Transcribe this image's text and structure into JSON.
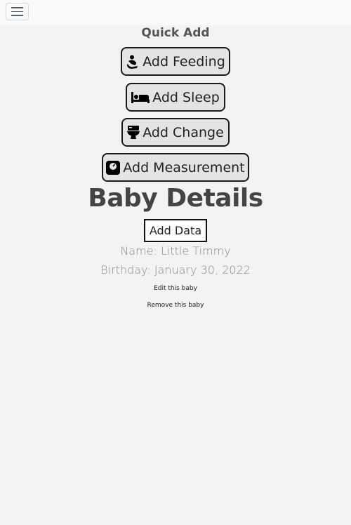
{
  "nav": {
    "menu_icon": "hamburger-menu-icon"
  },
  "quick_add": {
    "title": "Quick Add",
    "buttons": [
      {
        "label": "Add Feeding",
        "icon": "breastfeeding-icon"
      },
      {
        "label": "Add Sleep",
        "icon": "bed-icon"
      },
      {
        "label": "Add Change",
        "icon": "toilet-icon"
      },
      {
        "label": "Add Measurement",
        "icon": "weight-scale-icon"
      }
    ]
  },
  "details": {
    "title": "Baby Details",
    "add_data_label": "Add Data",
    "name": "Name: Little Timmy",
    "birthday": "Birthday: January 30, 2022",
    "edit_link": "Edit this baby",
    "remove_link": "Remove this baby"
  }
}
